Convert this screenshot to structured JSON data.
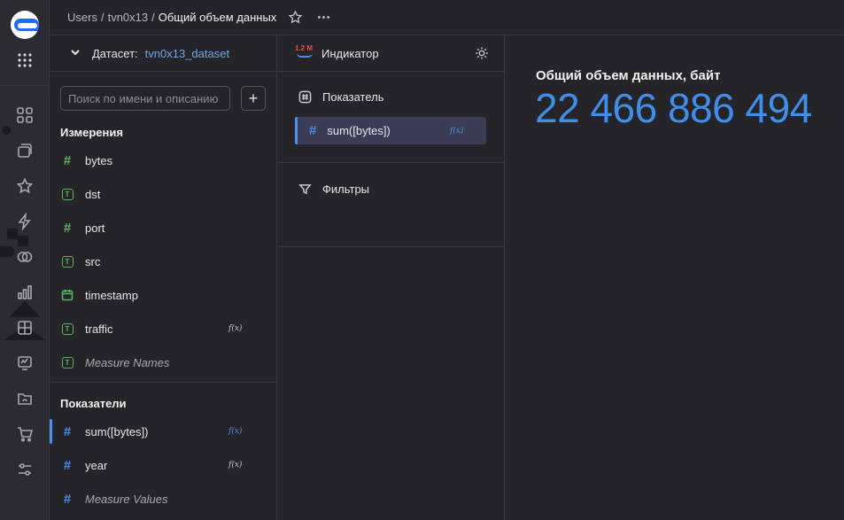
{
  "header": {
    "breadcrumbs": [
      "Users",
      "tvn0x13"
    ],
    "current": "Общий объем данных"
  },
  "dataset": {
    "label": "Датасет:",
    "name": "tvn0x13_dataset",
    "search_placeholder": "Поиск по имени и описанию",
    "add_label": "+",
    "dimensions_title": "Измерения",
    "dimensions": [
      {
        "name": "bytes",
        "type": "number"
      },
      {
        "name": "dst",
        "type": "text"
      },
      {
        "name": "port",
        "type": "number"
      },
      {
        "name": "src",
        "type": "text"
      },
      {
        "name": "timestamp",
        "type": "date"
      },
      {
        "name": "traffic",
        "type": "text",
        "fx": "f(x)"
      },
      {
        "name": "Measure Names",
        "type": "text"
      }
    ],
    "measures_title": "Показатели",
    "measures": [
      {
        "name": "sum([bytes])",
        "fx": "f(x)"
      },
      {
        "name": "year",
        "fx": "f(x)"
      },
      {
        "name": "Measure Values"
      }
    ]
  },
  "viz": {
    "badge": "1.2 M",
    "type_label": "Индикатор",
    "measure_section": "Показатель",
    "measure_chip": "sum([bytes])",
    "measure_chip_fx": "f(x)",
    "filters_section": "Фильтры"
  },
  "preview": {
    "title": "Общий объем данных, байт",
    "value": "22 466 886 494"
  },
  "colors": {
    "accent": "#4c8fe8",
    "value": "#3f8ee8",
    "dimension": "#5bb563"
  }
}
